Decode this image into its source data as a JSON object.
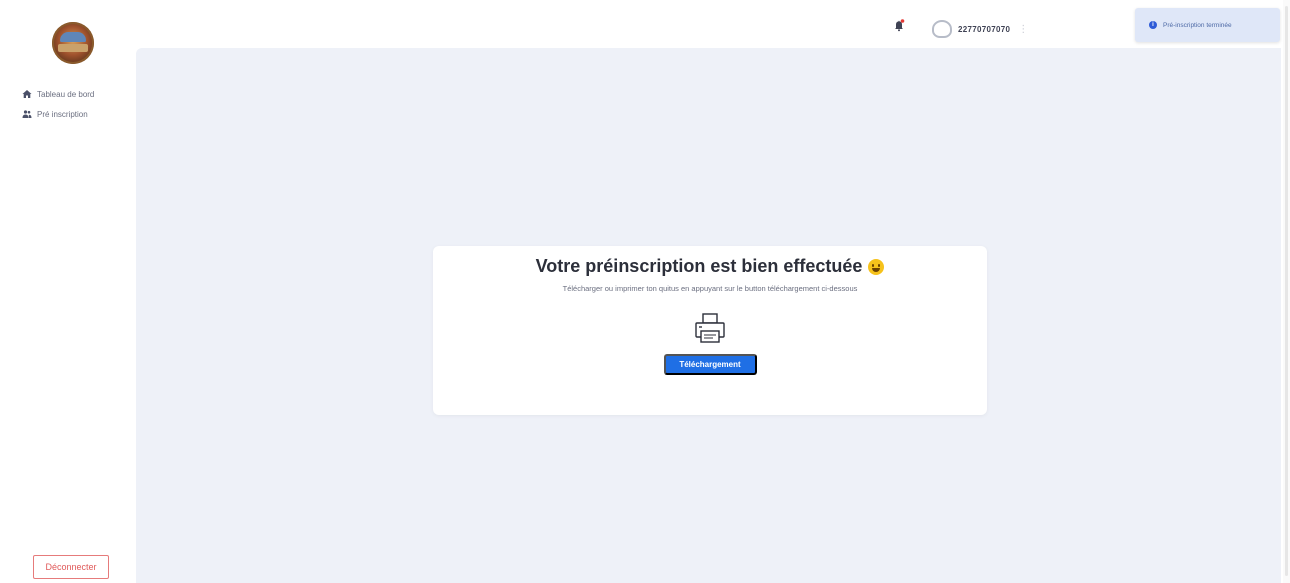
{
  "sidebar": {
    "items": [
      {
        "label": "Tableau de bord",
        "icon": "home-icon"
      },
      {
        "label": "Pré inscription",
        "icon": "users-icon"
      }
    ],
    "logout_label": "Déconnecter"
  },
  "topbar": {
    "user_phone": "22770707070",
    "menu_glyph": "⋮"
  },
  "toast": {
    "icon": "info-icon",
    "text": "Pré-inscription terminée"
  },
  "card": {
    "title": "Votre préinscription est bien effectuée",
    "subtitle": "Télécharger ou imprimer ton quitus en appuyant sur le button téléchargement ci-dessous",
    "button_label": "Téléchargement",
    "icon": "printer-icon"
  },
  "colors": {
    "accent": "#1f6fe5",
    "background": "#eef1f8",
    "logout": "#e05a5a",
    "notification_dot": "#e53935"
  }
}
